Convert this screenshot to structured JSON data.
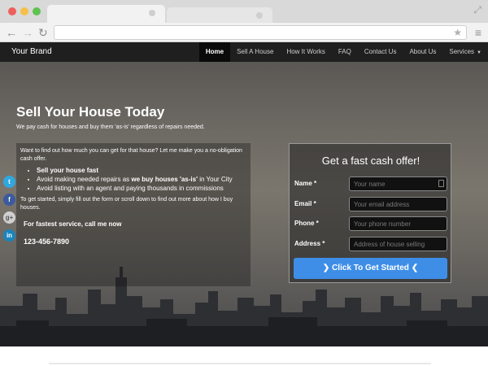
{
  "brand": "Your Brand",
  "nav": [
    {
      "label": "Home",
      "active": true
    },
    {
      "label": "Sell A House"
    },
    {
      "label": "How It Works"
    },
    {
      "label": "FAQ"
    },
    {
      "label": "Contact Us"
    },
    {
      "label": "About Us"
    },
    {
      "label": "Services",
      "dropdown": true
    }
  ],
  "hero": {
    "title": "Sell Your House Today",
    "subtitle": "We pay cash for houses and buy them 'as-is' regardless of repairs needed."
  },
  "info": {
    "intro": "Want to find out how much you can get for that house? Let me make you a no-obligation cash offer.",
    "bullets": {
      "b1": "Sell your house fast",
      "b2_pre": "Avoid making needed repairs as ",
      "b2_bold": "we buy houses 'as-is'",
      "b2_post": " in Your City",
      "b3": "Avoid listing with an agent and paying thousands in commissions"
    },
    "outro": "To get started, simply fill out the form or scroll down to find out more about how I buy houses.",
    "call_text": "For fastest service, call me now",
    "phone": "123-456-7890"
  },
  "form": {
    "title": "Get a fast cash offer!",
    "fields": {
      "name": {
        "label": "Name *",
        "placeholder": "Your name"
      },
      "email": {
        "label": "Email *",
        "placeholder": "Your email address"
      },
      "phone": {
        "label": "Phone *",
        "placeholder": "Your phone number"
      },
      "address": {
        "label": "Address *",
        "placeholder": "Address of house selling"
      }
    },
    "submit_label": "❯ Click To Get Started ❮"
  },
  "social": {
    "twitter": "t",
    "facebook": "f",
    "googleplus": "g+",
    "linkedin": "in"
  },
  "colors": {
    "navbar": "#1f1f1f",
    "submit": "#3e8ee8",
    "twitter": "#2fa8e0",
    "facebook": "#3b5b9e",
    "linkedin": "#1a85bc"
  },
  "icons": {
    "back": "back-arrow-icon",
    "forward": "forward-arrow-icon",
    "reload": "reload-icon",
    "bookmark": "star-icon",
    "menu": "hamburger-menu-icon",
    "caret": "caret-down-icon"
  }
}
